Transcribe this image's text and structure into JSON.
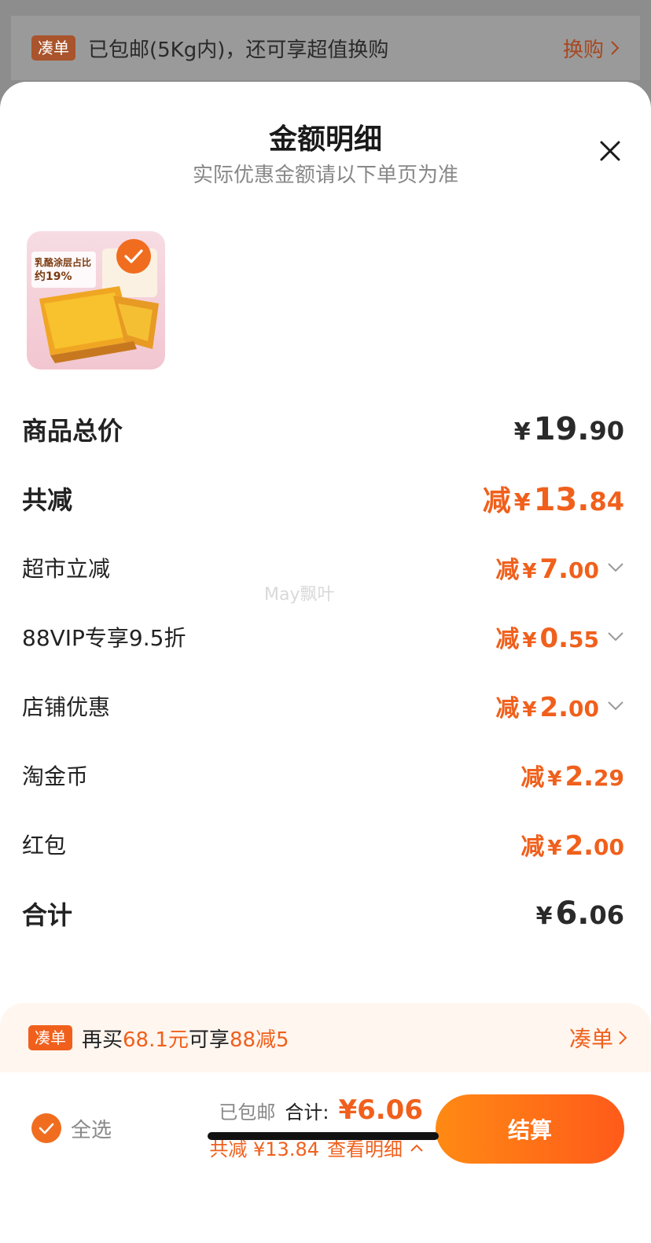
{
  "banner": {
    "tag": "凑单",
    "text": "已包邮(5Kg内)，还可享超值换购",
    "action": "换购"
  },
  "sheet": {
    "title": "金额明细",
    "subtitle": "实际优惠金额请以下单页为准",
    "product_image_alt": "乳酪涂层占比约19%",
    "product_img_text1": "乳酪涂层占比",
    "product_img_text2": "约19%"
  },
  "rows": [
    {
      "label": "商品总价",
      "prefix": "",
      "yen": "¥",
      "int": "19.",
      "dec": "90"
    },
    {
      "label": "共减",
      "prefix": "减",
      "yen": "¥",
      "int": "13.",
      "dec": "84"
    },
    {
      "label": "超市立减",
      "prefix": "减",
      "yen": "¥",
      "int": "7.",
      "dec": "00"
    },
    {
      "label": "88VIP专享9.5折",
      "prefix": "减",
      "yen": "¥",
      "int": "0.",
      "dec": "55"
    },
    {
      "label": "店铺优惠",
      "prefix": "减",
      "yen": "¥",
      "int": "2.",
      "dec": "00"
    },
    {
      "label": "淘金币",
      "prefix": "减",
      "yen": "¥",
      "int": "2.",
      "dec": "29"
    },
    {
      "label": "红包",
      "prefix": "减",
      "yen": "¥",
      "int": "2.",
      "dec": "00"
    },
    {
      "label": "合计",
      "prefix": "",
      "yen": "¥",
      "int": "6.",
      "dec": "06"
    }
  ],
  "watermark": "May飘叶",
  "promo": {
    "tag": "凑单",
    "text_a": "再买",
    "amount": "68.1元",
    "text_b": "可享",
    "deal": "88减5",
    "action": "凑单"
  },
  "footer": {
    "select_all": "全选",
    "shipping": "已包邮",
    "total_label": "合计:",
    "total_value": "¥6.06",
    "discount_text": "共减 ¥13.84",
    "detail_link": "查看明细",
    "checkout": "结算"
  },
  "colors": {
    "accent": "#f0601c",
    "checkout_start": "#ff8a14",
    "checkout_end": "#ff5a1a"
  }
}
